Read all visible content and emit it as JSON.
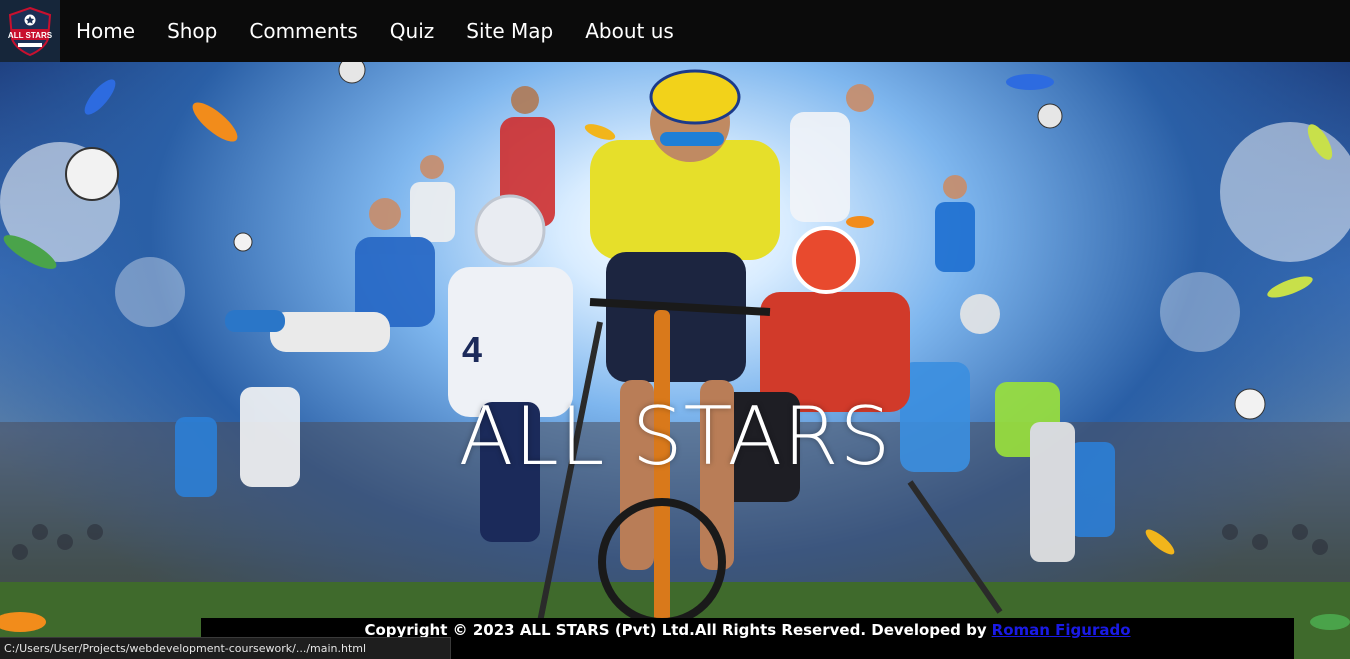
{
  "navbar": {
    "logo_text": "ALL STARS",
    "links": [
      "Home",
      "Shop",
      "Comments",
      "Quiz",
      "Site Map",
      "About us"
    ]
  },
  "hero": {
    "title": "ALL STARS",
    "image": "sports-athletes-collage"
  },
  "footer": {
    "copyright": "Copyright © 2023 ALL STARS (Pvt) Ltd.All Rights Reserved. Developed by",
    "developer_link": "Roman Figurado"
  },
  "status_bar": {
    "url": "C:/Users/User/Projects/webdevelopment-coursework/.../main.html"
  },
  "colors": {
    "navbar_bg": "#0b0b0b",
    "footer_bg": "#000000",
    "link_blue": "#1a1ae6",
    "text": "#ffffff"
  }
}
